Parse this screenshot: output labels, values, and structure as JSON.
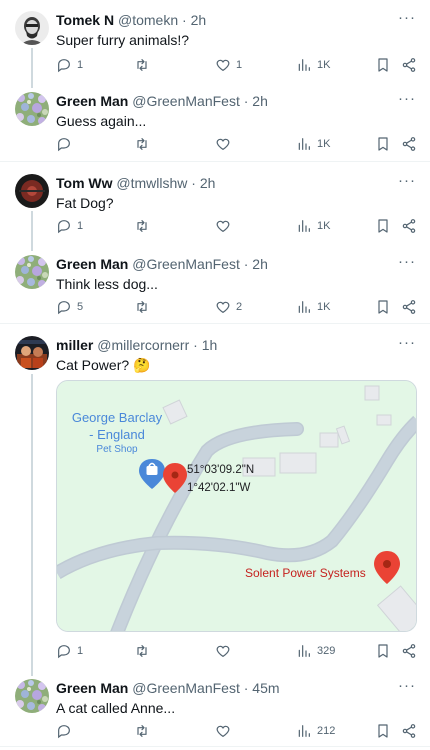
{
  "posts": [
    {
      "name": "Tomek N",
      "handle": "@tomekn",
      "time": "2h",
      "text": "Super furry animals!?",
      "replies": "1",
      "retweets": "",
      "likes": "1",
      "views": "1K"
    },
    {
      "name": "Green Man",
      "handle": "@GreenManFest",
      "time": "2h",
      "text": "Guess again...",
      "replies": "",
      "retweets": "",
      "likes": "",
      "views": "1K"
    },
    {
      "name": "Tom Ww",
      "handle": "@tmwllshw",
      "time": "2h",
      "text": "Fat Dog?",
      "replies": "1",
      "retweets": "",
      "likes": "",
      "views": "1K"
    },
    {
      "name": "Green Man",
      "handle": "@GreenManFest",
      "time": "2h",
      "text": "Think less dog...",
      "replies": "5",
      "retweets": "",
      "likes": "2",
      "views": "1K"
    },
    {
      "name": "miller",
      "handle": "@millercornerr",
      "time": "1h",
      "text": "Cat Power? 🤔",
      "replies": "1",
      "retweets": "",
      "likes": "",
      "views": "329"
    },
    {
      "name": "Green Man",
      "handle": "@GreenManFest",
      "time": "45m",
      "text": "A cat called Anne...",
      "replies": "",
      "retweets": "",
      "likes": "",
      "views": "212"
    }
  ],
  "separator": " · ",
  "more_glyph": "···",
  "map": {
    "place_name_line1": "George Barclay",
    "place_name_line2": "- England",
    "place_category": "Pet Shop",
    "coord_lat": "51°03'09.2\"N",
    "coord_lon": "1°42'02.1\"W",
    "business_name": "Solent Power Systems"
  },
  "icons": [
    "reply-icon",
    "retweet-icon",
    "like-icon",
    "views-icon",
    "bookmark-icon",
    "share-icon",
    "more-icon",
    "map-pin-icon",
    "shop-pin-icon"
  ],
  "colors": {
    "accent": "#1d9bf0",
    "text": "#0f1419",
    "muted": "#536471",
    "pin_red": "#ea4335",
    "map_green": "#e3f7e6",
    "road": "#c8d3dc",
    "place_blue": "#4a88d9",
    "business_red": "#c5221f"
  }
}
